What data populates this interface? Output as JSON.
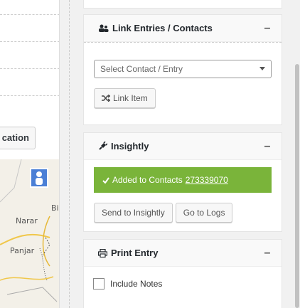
{
  "left": {
    "button_label": "cation",
    "map_labels": [
      "Narar",
      "Panjar",
      "Bi"
    ]
  },
  "link_panel": {
    "title": "Link Entries / Contacts",
    "toggle": "–",
    "select_placeholder": "Select Contact / Entry",
    "link_button": "Link Item"
  },
  "insightly_panel": {
    "title": "Insightly",
    "toggle": "–",
    "notice_text": "Added to Contacts",
    "notice_link": "273339070",
    "send_button": "Send to Insightly",
    "logs_button": "Go to Logs"
  },
  "print_panel": {
    "title": "Print Entry",
    "toggle": "–",
    "include_notes": "Include Notes"
  },
  "colors": {
    "success": "#7ab43a",
    "panel_bg": "#ffffff",
    "page_bg": "#f1f1f1"
  }
}
